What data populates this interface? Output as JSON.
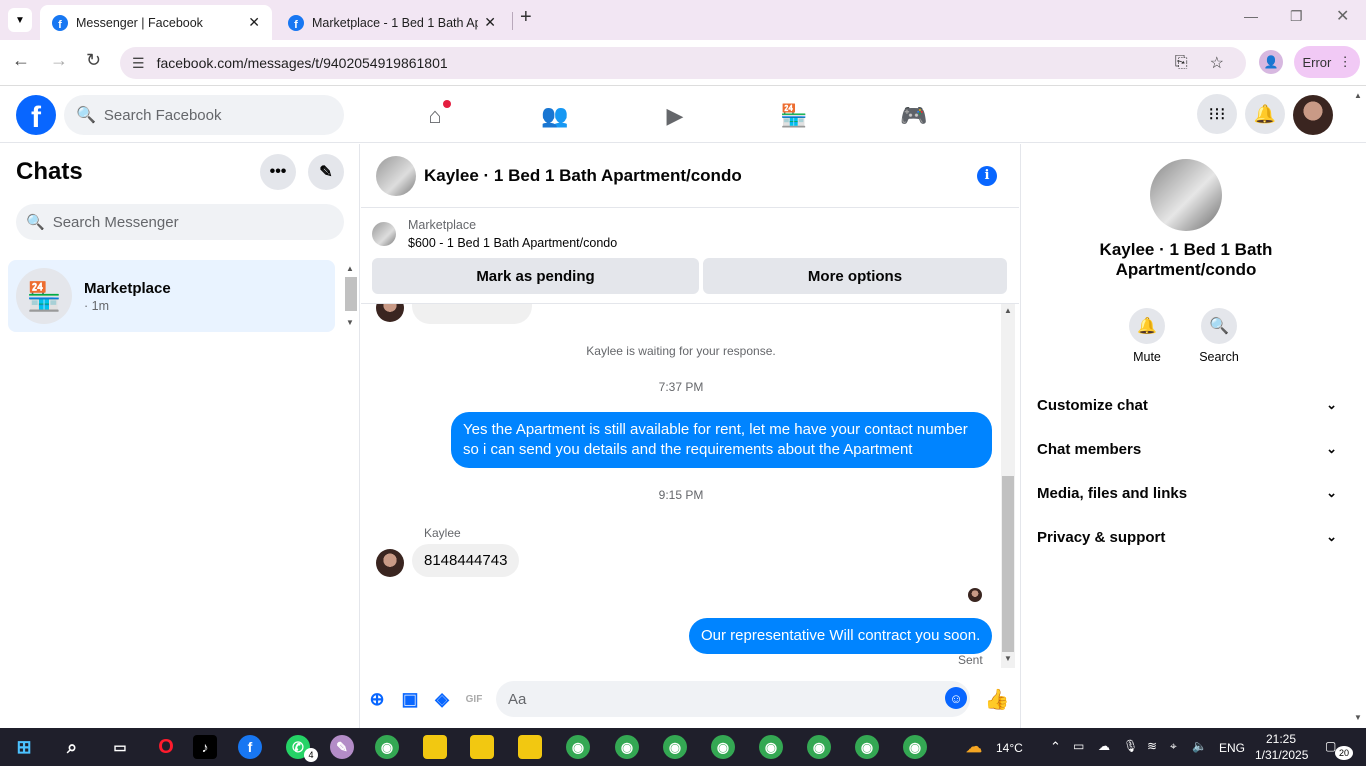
{
  "browser": {
    "tabs": [
      {
        "title": "Messenger | Facebook"
      },
      {
        "title": "Marketplace - 1 Bed 1 Bath Apa"
      }
    ],
    "url": "facebook.com/messages/t/9402054919861801",
    "error_label": "Error"
  },
  "fb": {
    "search_placeholder": "Search Facebook"
  },
  "left": {
    "title": "Chats",
    "search_placeholder": "Search Messenger",
    "chat": {
      "name": "Marketplace",
      "time": "· 1m"
    }
  },
  "thread": {
    "header_name": "Kaylee · 1 Bed 1 Bath Apartment/condo",
    "marketplace_label": "Marketplace",
    "listing": "$600 - 1 Bed 1 Bath Apartment/condo",
    "btn_pending": "Mark as pending",
    "btn_more": "More options",
    "waiting": "Kaylee is waiting for your response.",
    "time1": "7:37 PM",
    "msg_out1": "Yes the Apartment is still available for rent, let me have your contact number so i can send you details and the requirements about the Apartment",
    "time2": "9:15 PM",
    "sender": "Kaylee",
    "msg_in1": "8148444743",
    "msg_out2": "Our representative Will contract you soon.",
    "status": "Sent",
    "composer_placeholder": "Aa"
  },
  "right": {
    "name": "Kaylee · 1 Bed 1 Bath Apartment/condo",
    "actions": [
      {
        "label": "Mute"
      },
      {
        "label": "Search"
      }
    ],
    "sections": [
      {
        "label": "Customize chat"
      },
      {
        "label": "Chat members"
      },
      {
        "label": "Media, files and links"
      },
      {
        "label": "Privacy & support"
      }
    ]
  },
  "taskbar": {
    "temperature": "14°C",
    "lang": "ENG",
    "time": "21:25",
    "date": "1/31/2025",
    "whatsapp_badge": "4",
    "notif_count": "20"
  },
  "colors": {
    "fb_blue": "#0866ff",
    "bubble_blue": "#0084ff",
    "chrome_bg": "#f2e6f3"
  }
}
